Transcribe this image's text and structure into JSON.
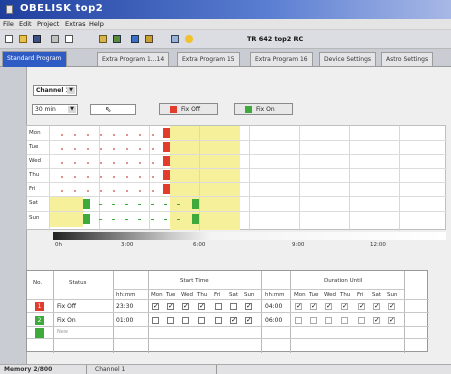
{
  "window": {
    "title": "OBELISK top2"
  },
  "menu": [
    "File",
    "Edit",
    "Project",
    "Extras",
    "Help"
  ],
  "toolbar": {
    "device_label": "TR 642 top2 RC"
  },
  "tabs": [
    "Standard Program",
    "Extra Program 1...14",
    "Extra Program 15",
    "Extra Program 16",
    "Device Settings",
    "Astro Settings"
  ],
  "controls": {
    "channel": "Channel 1",
    "interval": "30 min",
    "fix_off_label": "Fix Off",
    "fix_on_label": "Fix On"
  },
  "schedule": {
    "days": [
      "Mon",
      "Tue",
      "Wed",
      "Thu",
      "Fri",
      "Sat",
      "Sun"
    ],
    "time_ticks": [
      "0h",
      "3:00",
      "6:00",
      "9:00",
      "12:00"
    ]
  },
  "table": {
    "headers": {
      "no": "No.",
      "status": "Status",
      "start_time": "Start Time",
      "duration": "Duration Until",
      "hhmm": "hh:mm",
      "hhmm2": "hh:mm"
    },
    "day_headers": [
      "Mon",
      "Tue",
      "Wed",
      "Thu",
      "Fri",
      "Sat",
      "Sun"
    ],
    "rows": [
      {
        "no": "1",
        "status": "Fix Off",
        "time": "23:30",
        "days": [
          true,
          true,
          true,
          true,
          false,
          false,
          true
        ],
        "until": "04:00",
        "dur_days": [
          true,
          true,
          true,
          true,
          true,
          true,
          true
        ]
      },
      {
        "no": "2",
        "status": "Fix On",
        "time": "01:00",
        "days": [
          false,
          false,
          false,
          false,
          false,
          true,
          true
        ],
        "until": "06:00",
        "dur_days": [
          false,
          false,
          false,
          false,
          false,
          true,
          true
        ]
      }
    ],
    "new_row": "New"
  },
  "statusbar": {
    "memory": "Memory 2/800",
    "channel": "Channel 1"
  },
  "colors": {
    "red": "#e23c2f",
    "green": "#3faa3c",
    "yellow": "#f6f09a",
    "titlebar": "#1f3f9e"
  }
}
